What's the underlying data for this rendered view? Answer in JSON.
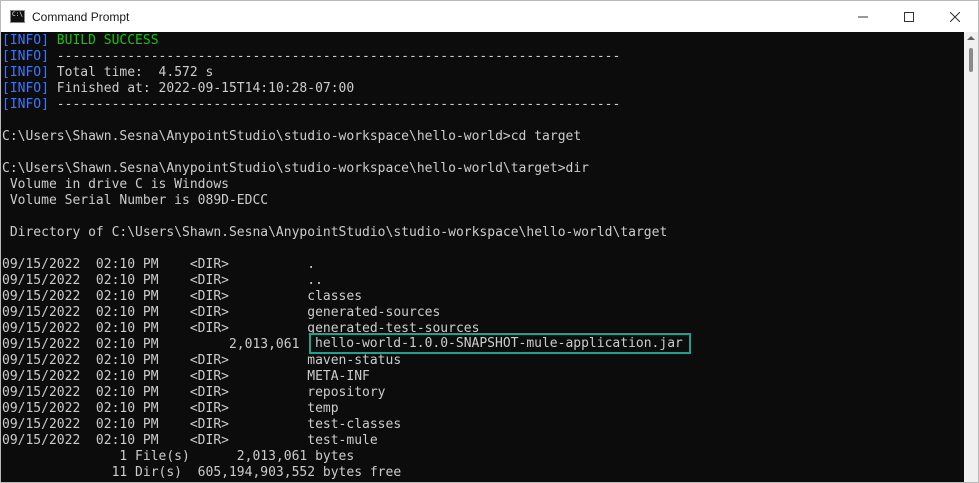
{
  "window": {
    "title": "Command Prompt",
    "controls": {
      "minimize": "minimize-icon",
      "maximize": "maximize-icon",
      "close": "close-icon"
    }
  },
  "colors": {
    "info_tag": "#3b78ff",
    "success": "#16c60c",
    "text": "#cccccc",
    "background": "#0c0c0c",
    "highlight_border": "#1ea28d"
  },
  "console": {
    "info_lines": [
      {
        "tag": "[INFO]",
        "text": " BUILD SUCCESS"
      },
      {
        "tag": "[INFO]",
        "text": " ------------------------------------------------------------------------"
      },
      {
        "tag": "[INFO]",
        "text": " Total time:  4.572 s"
      },
      {
        "tag": "[INFO]",
        "text": " Finished at: 2022-09-15T14:10:28-07:00"
      },
      {
        "tag": "[INFO]",
        "text": " ------------------------------------------------------------------------"
      }
    ],
    "prompt1": "C:\\Users\\Shawn.Sesna\\AnypointStudio\\studio-workspace\\hello-world>cd target",
    "prompt2": "C:\\Users\\Shawn.Sesna\\AnypointStudio\\studio-workspace\\hello-world\\target>dir",
    "volume_label": " Volume in drive C is Windows",
    "volume_serial": " Volume Serial Number is 089D-EDCC",
    "directory_of": " Directory of C:\\Users\\Shawn.Sesna\\AnypointStudio\\studio-workspace\\hello-world\\target",
    "dir_rows": [
      "09/15/2022  02:10 PM    <DIR>          .",
      "09/15/2022  02:10 PM    <DIR>          ..",
      "09/15/2022  02:10 PM    <DIR>          classes",
      "09/15/2022  02:10 PM    <DIR>          generated-sources",
      "09/15/2022  02:10 PM    <DIR>          generated-test-sources",
      "09/15/2022  02:10 PM         2,013,061 ",
      "09/15/2022  02:10 PM    <DIR>          maven-status",
      "09/15/2022  02:10 PM    <DIR>          META-INF",
      "09/15/2022  02:10 PM    <DIR>          repository",
      "09/15/2022  02:10 PM    <DIR>          temp",
      "09/15/2022  02:10 PM    <DIR>          test-classes",
      "09/15/2022  02:10 PM    <DIR>          test-mule"
    ],
    "highlighted_file": "hello-world-1.0.0-SNAPSHOT-mule-application.jar",
    "summary_files": "               1 File(s)      2,013,061 bytes",
    "summary_dirs": "              11 Dir(s)  605,194,903,552 bytes free"
  }
}
